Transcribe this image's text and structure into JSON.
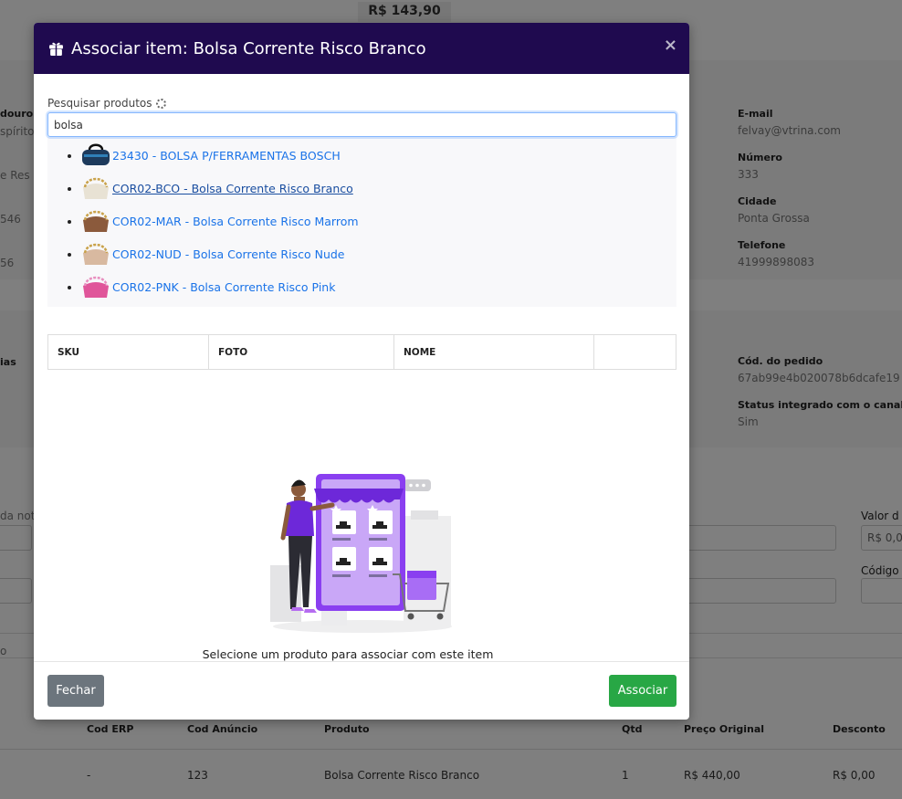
{
  "background": {
    "total": "R$ 143,90",
    "left_fragments": [
      "douro",
      "spírito",
      "e Res",
      "546",
      "56",
      "ias",
      "da nota",
      "o"
    ],
    "right_fields": [
      {
        "label": "E-mail",
        "value": "felvay@vtrina.com"
      },
      {
        "label": "Número",
        "value": "333"
      },
      {
        "label": "Cidade",
        "value": "Ponta Grossa"
      },
      {
        "label": "Telefone",
        "value": "41999898083"
      },
      {
        "label": "Cód. do pedido",
        "value": "67ab99e4b020078b6dcafe19"
      },
      {
        "label": "Status integrado com o canal de",
        "value": "Sim"
      }
    ],
    "valor_label": "Valor d",
    "valor_input": "R$ 0,0",
    "codigo_label": "Código",
    "table_headers": [
      "Cod ERP",
      "Cod Anúncio",
      "Produto",
      "Qtd",
      "Preço Original",
      "Desconto"
    ],
    "table_row": [
      "-",
      "123",
      "Bolsa Corrente Risco Branco",
      "1",
      "R$ 440,00",
      "R$ 0,00"
    ]
  },
  "modal": {
    "title": "Associar item: Bolsa Corrente Risco Branco",
    "close_symbol": "×",
    "search": {
      "label": "Pesquisar produtos",
      "value": "bolsa"
    },
    "results": [
      {
        "label": "23430 - BOLSA P/FERRAMENTAS BOSCH",
        "thumb": "tool-bag-thumbnail",
        "color": "#1d3a5c"
      },
      {
        "label": "COR02-BCO - Bolsa Corrente Risco Branco",
        "thumb": "white-bag-thumbnail",
        "color": "#e8e2d4"
      },
      {
        "label": "COR02-MAR - Bolsa Corrente Risco Marrom",
        "thumb": "brown-bag-thumbnail",
        "color": "#8b5a3c"
      },
      {
        "label": "COR02-NUD - Bolsa Corrente Risco Nude",
        "thumb": "nude-bag-thumbnail",
        "color": "#d8b9a0"
      },
      {
        "label": "COR02-PNK - Bolsa Corrente Risco Pink",
        "thumb": "pink-bag-thumbnail",
        "color": "#e0559a"
      }
    ],
    "table_headers": [
      "SKU",
      "FOTO",
      "NOME",
      ""
    ],
    "empty_message": "Selecione um produto para associar com este item",
    "buttons": {
      "close": "Fechar",
      "associate": "Associar"
    }
  },
  "colors": {
    "header_bg": "#1f0a4f",
    "link": "#1a73e8",
    "close_button": "#6c757d",
    "associate_button": "#28a745",
    "illustration_purple": "#8a3ff0"
  }
}
